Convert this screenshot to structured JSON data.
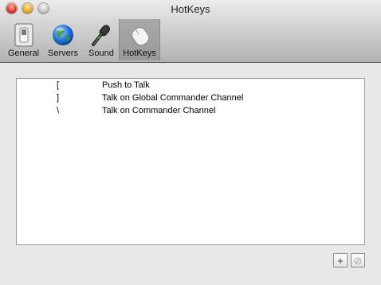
{
  "window": {
    "title": "HotKeys"
  },
  "toolbar": {
    "items": [
      {
        "label": "General",
        "icon": "switch-icon",
        "selected": false
      },
      {
        "label": "Servers",
        "icon": "globe-icon",
        "selected": false
      },
      {
        "label": "Sound",
        "icon": "microphone-icon",
        "selected": false
      },
      {
        "label": "HotKeys",
        "icon": "mouse-icon",
        "selected": true
      }
    ]
  },
  "hotkeys": {
    "rows": [
      {
        "key": "[",
        "action": "Push to Talk"
      },
      {
        "key": "]",
        "action": "Talk on Global Commander Channel"
      },
      {
        "key": "\\",
        "action": "Talk on Commander Channel"
      }
    ]
  },
  "buttons": {
    "add": "+",
    "remove": "⊘"
  },
  "colors": {
    "close": "#e23a2c",
    "minimize": "#e9a82b",
    "zoom": "#c8c8c8"
  }
}
